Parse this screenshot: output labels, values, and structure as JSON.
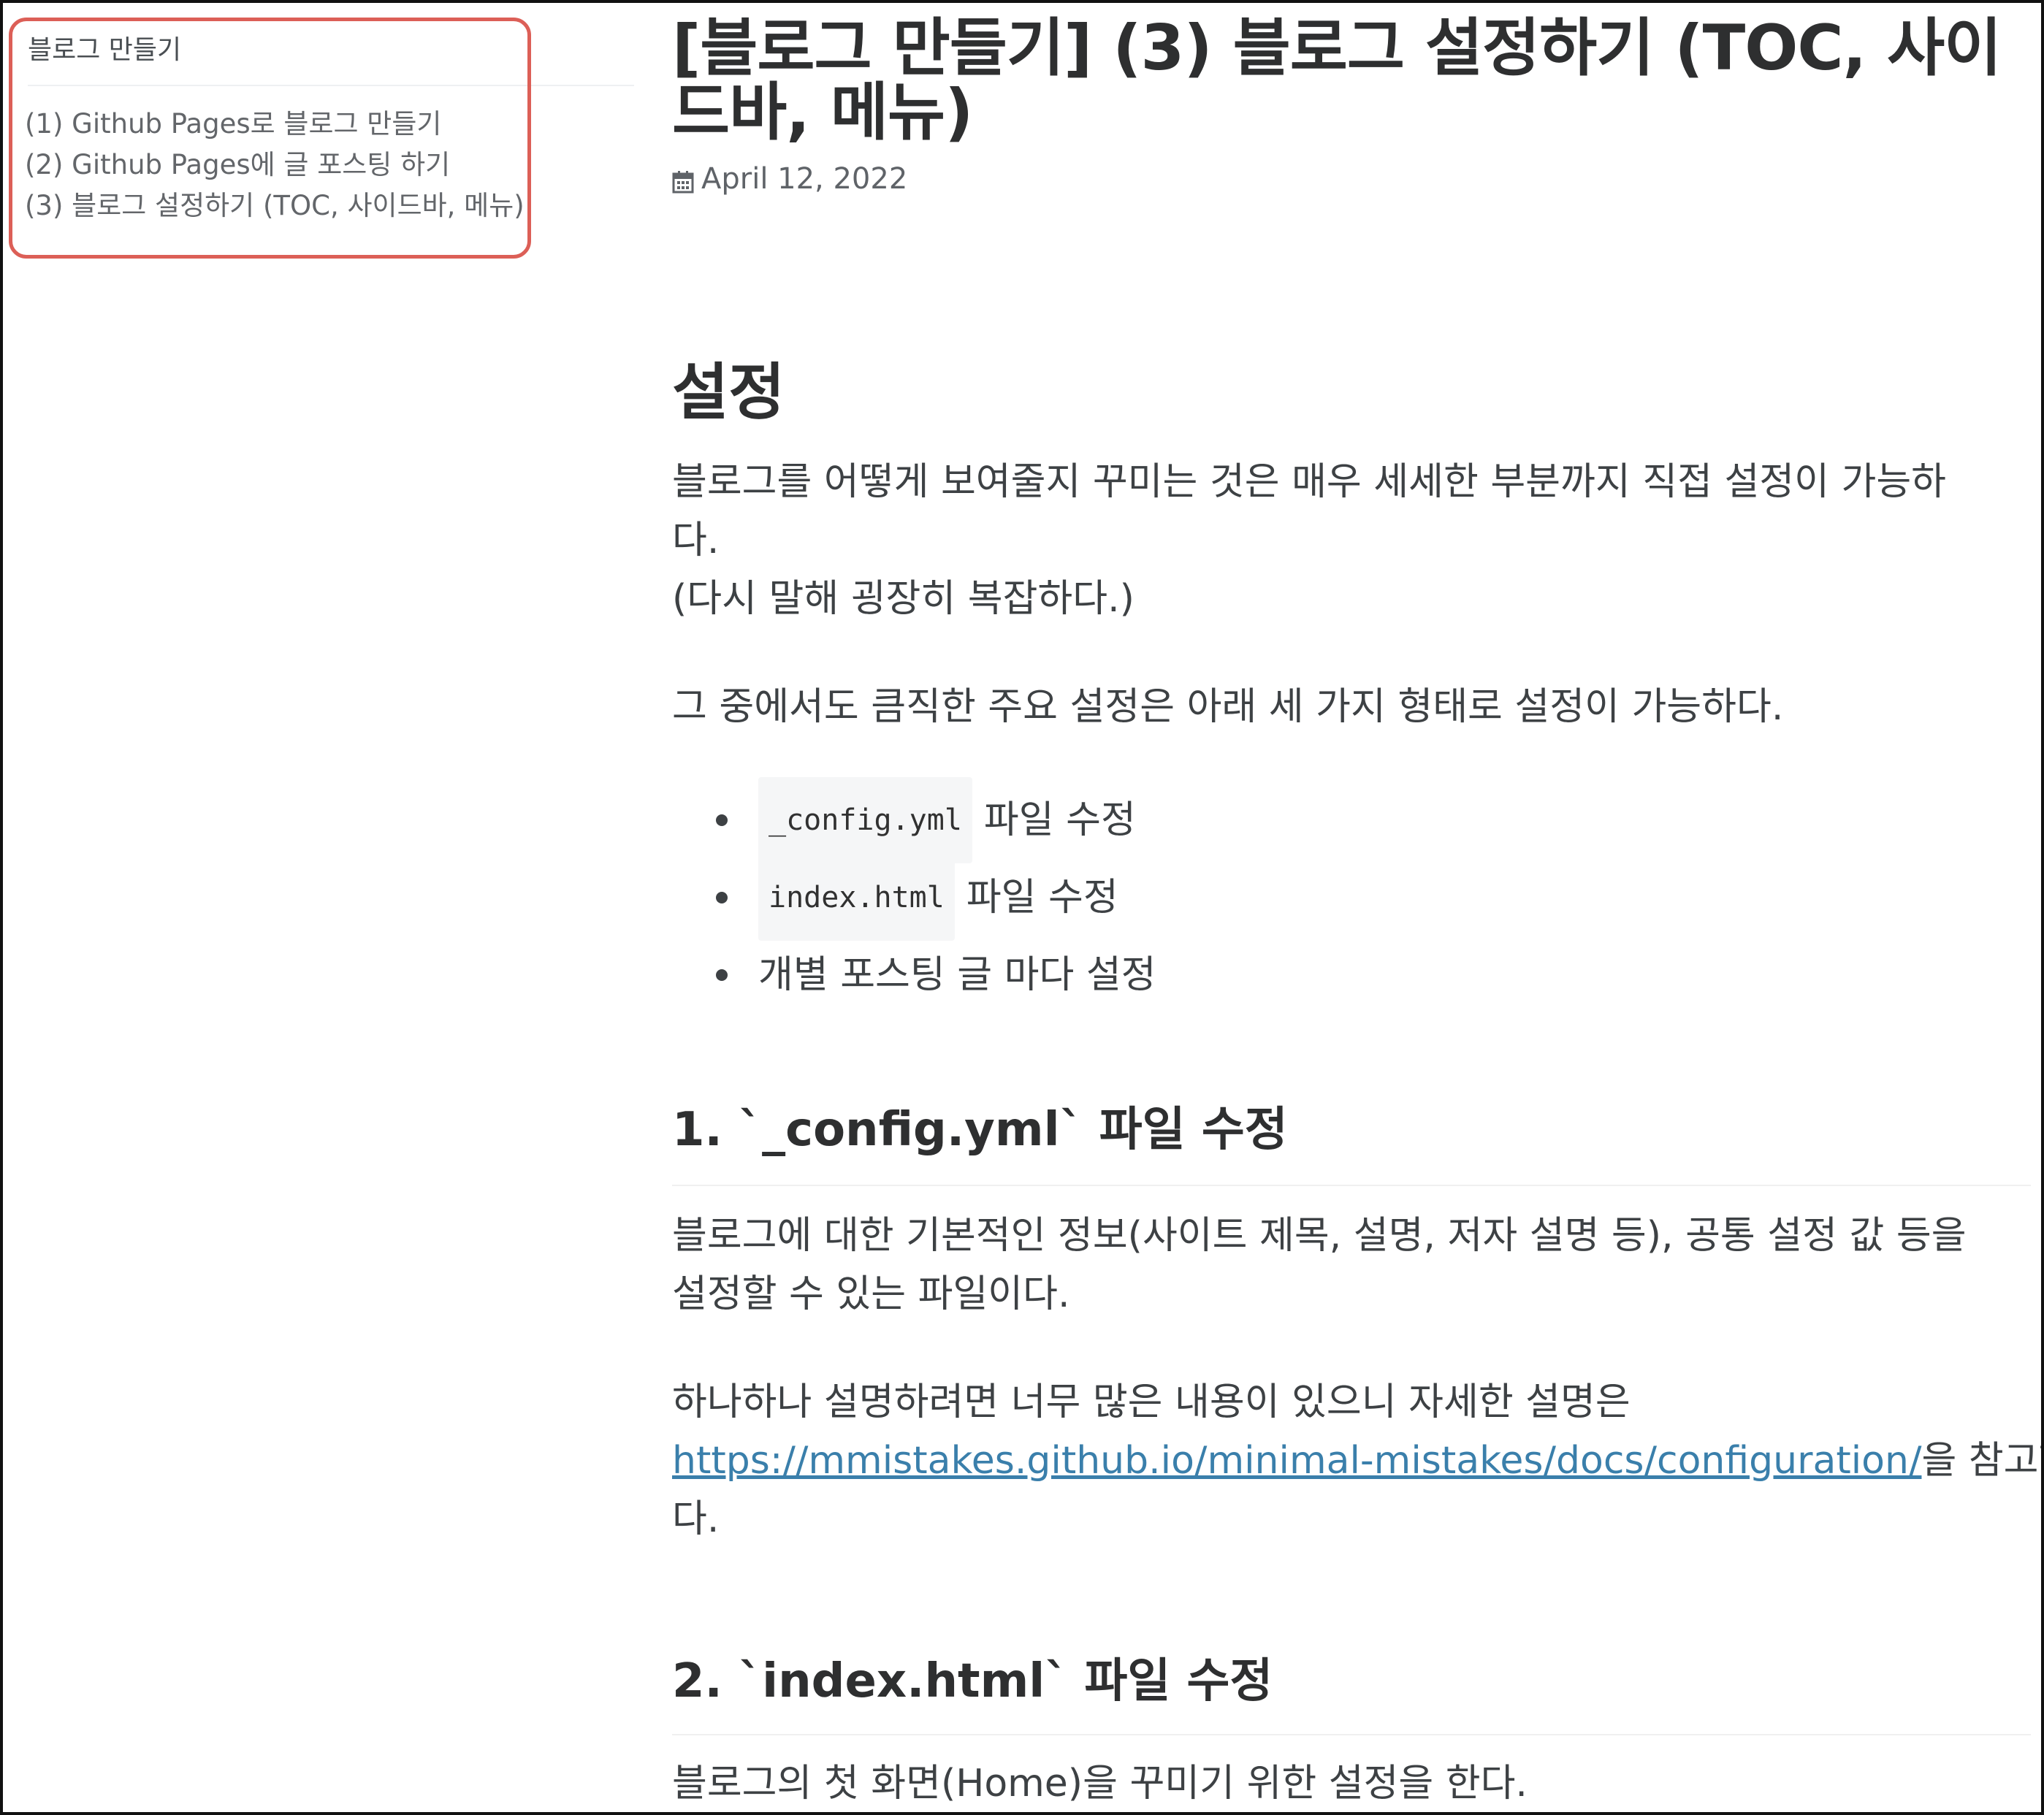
{
  "sidebar": {
    "title": "블로그 만들기",
    "items": [
      {
        "label": "(1) Github Pages로 블로그 만들기"
      },
      {
        "label": "(2) Github Pages에 글 포스팅 하기"
      },
      {
        "label": "(3) 블로그 설정하기 (TOC, 사이드바, 메뉴)"
      }
    ]
  },
  "post": {
    "title": "[블로그 만들기] (3) 블로그 설정하기 (TOC, 사이드바, 메뉴)",
    "date": "April 12, 2022",
    "sections": {
      "settings": {
        "heading": "설정",
        "p1_line1": "블로그를 어떻게 보여줄지 꾸미는 것은 매우 세세한 부분까지 직접 설정이 가능하",
        "p1_line2": "다.",
        "p1_line3": "(다시 말해 굉장히 복잡하다.)",
        "p2": "그 중에서도 큼직한 주요 설정은 아래 세 가지 형태로 설정이 가능하다.",
        "bullets": [
          {
            "code": "_config.yml",
            "text": "파일 수정"
          },
          {
            "code": "index.html",
            "text": "파일 수정"
          },
          {
            "code": "",
            "text": "개별 포스팅 글 마다 설정"
          }
        ]
      },
      "config": {
        "heading": "1. `_config.yml` 파일 수정",
        "p1_line1": "블로그에 대한 기본적인 정보(사이트 제목, 설명, 저자 설명 등), 공통 설정 값 등을",
        "p1_line2": "설정할 수 있는 파일이다.",
        "p2_line1": "하나하나 설명하려면 너무 많은 내용이 있으니 자세한 설명은",
        "p2_link": "https://mmistakes.github.io/minimal-mistakes/docs/configuration/",
        "p2_after_link": "을 참고한",
        "p2_line3": "다."
      },
      "index": {
        "heading": "2. `index.html` 파일 수정",
        "p1": "블로그의 첫 화면(Home)을 꾸미기 위한 설정을 한다."
      }
    }
  },
  "colors": {
    "highlight_border": "#dc5f57",
    "link": "#3a7fab",
    "text": "#3d4144",
    "heading": "#2e2f30"
  },
  "icons": {
    "date": "calendar-icon"
  }
}
